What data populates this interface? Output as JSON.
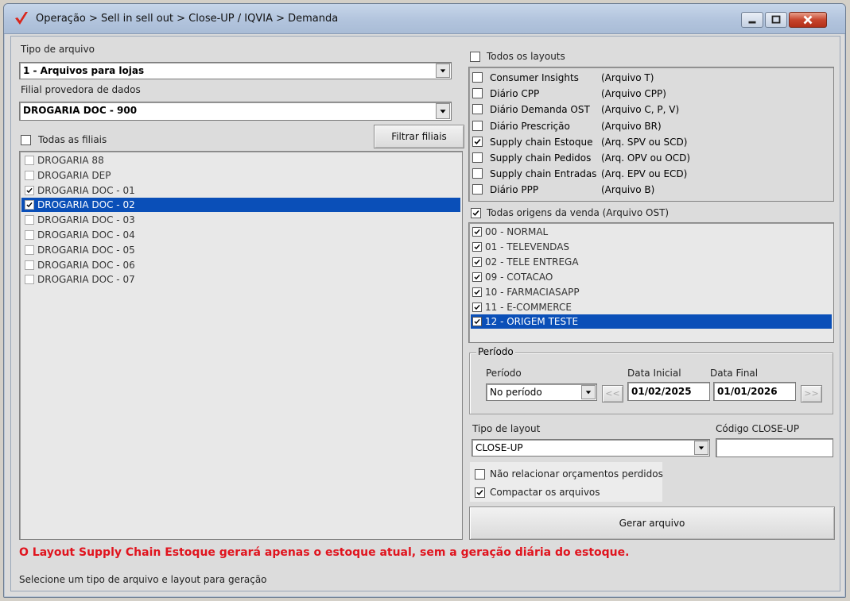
{
  "window": {
    "title": "Operação > Sell in sell out > Close-UP / IQVIA > Demanda",
    "logo_icon": "red-checkmark-logo",
    "controls": [
      "minimize-icon",
      "maximize-icon",
      "close-icon"
    ]
  },
  "left": {
    "tipo_arquivo_label": "Tipo de arquivo",
    "tipo_arquivo_value": "1 - Arquivos para lojas",
    "filial_provedora_label": "Filial provedora de dados",
    "filial_provedora_value": "DROGARIA DOC - 900",
    "todas_filiais_label": "Todas as filiais",
    "todas_filiais_checked": false,
    "filtrar_button": "Filtrar filiais",
    "filiais": [
      {
        "label": "DROGARIA 88",
        "checked": false,
        "selected": false
      },
      {
        "label": "DROGARIA DEP",
        "checked": false,
        "selected": false
      },
      {
        "label": "DROGARIA DOC - 01",
        "checked": true,
        "selected": false
      },
      {
        "label": "DROGARIA DOC - 02",
        "checked": true,
        "selected": true
      },
      {
        "label": "DROGARIA DOC - 03",
        "checked": false,
        "selected": false
      },
      {
        "label": "DROGARIA DOC - 04",
        "checked": false,
        "selected": false
      },
      {
        "label": "DROGARIA DOC - 05",
        "checked": false,
        "selected": false
      },
      {
        "label": "DROGARIA DOC - 06",
        "checked": false,
        "selected": false
      },
      {
        "label": "DROGARIA DOC - 07",
        "checked": false,
        "selected": false
      }
    ]
  },
  "right": {
    "todos_layouts_label": "Todos os layouts",
    "todos_layouts_checked": false,
    "layouts": [
      {
        "name": "Consumer Insights",
        "code": "(Arquivo T)",
        "checked": false
      },
      {
        "name": "Diário CPP",
        "code": "(Arquivo CPP)",
        "checked": false
      },
      {
        "name": "Diário Demanda OST",
        "code": "(Arquivo C, P, V)",
        "checked": false
      },
      {
        "name": "Diário Prescrição",
        "code": "(Arquivo BR)",
        "checked": false
      },
      {
        "name": "Supply chain Estoque",
        "code": "(Arq. SPV ou SCD)",
        "checked": true
      },
      {
        "name": "Supply chain Pedidos",
        "code": "(Arq. OPV ou OCD)",
        "checked": false
      },
      {
        "name": " Supply chain Entradas",
        "code": "(Arq. EPV ou ECD)",
        "checked": false
      },
      {
        "name": "Diário PPP",
        "code": "(Arquivo B)",
        "checked": false
      }
    ],
    "todas_origens_label": "Todas origens da venda (Arquivo OST)",
    "todas_origens_checked": true,
    "origens": [
      {
        "label": "00 - NORMAL",
        "checked": true,
        "selected": false
      },
      {
        "label": "01 - TELEVENDAS",
        "checked": true,
        "selected": false
      },
      {
        "label": "02 - TELE ENTREGA",
        "checked": true,
        "selected": false
      },
      {
        "label": "09 - COTACAO",
        "checked": true,
        "selected": false
      },
      {
        "label": "10 - FARMACIASAPP",
        "checked": true,
        "selected": false
      },
      {
        "label": "11 - E-COMMERCE",
        "checked": true,
        "selected": false
      },
      {
        "label": "12 - ORIGEM TESTE",
        "checked": true,
        "selected": true
      }
    ],
    "periodo_group": "Período",
    "periodo_label": "Período",
    "periodo_value": "No período",
    "prev_button": "<<",
    "next_button": ">>",
    "data_inicial_label": "Data Inicial",
    "data_inicial_value": "01/02/2025",
    "data_final_label": "Data Final",
    "data_final_value": "01/01/2026",
    "tipo_layout_label": "Tipo de layout",
    "tipo_layout_value": "CLOSE-UP",
    "codigo_label": "Código CLOSE-UP",
    "codigo_value": "",
    "nao_relacionar_label": "Não relacionar orçamentos perdidos",
    "nao_relacionar_checked": false,
    "compactar_label": "Compactar os arquivos",
    "compactar_checked": true,
    "gerar_button": "Gerar arquivo"
  },
  "warning": "O Layout Supply Chain Estoque gerará apenas o estoque atual, sem a geração diária do estoque.",
  "status": "Selecione um tipo de arquivo e layout para geração",
  "colors": {
    "selection": "#0a4fb8",
    "warning": "#e0141e",
    "logo": "#d9261c"
  }
}
